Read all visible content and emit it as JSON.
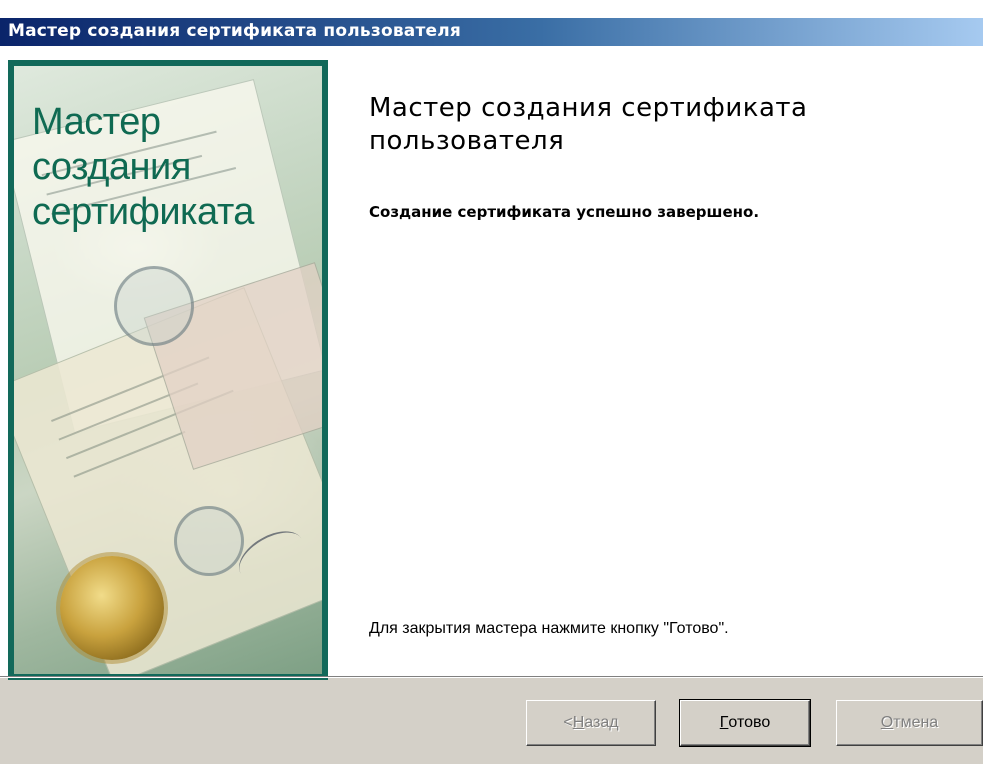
{
  "window": {
    "title": "Мастер создания сертификата пользователя"
  },
  "side_panel": {
    "title_lines": [
      "Мастер",
      "создания",
      "сертификата"
    ]
  },
  "main": {
    "title": "Мастер создания сертификата пользователя",
    "subtitle": "Создание сертификата успешно завершено.",
    "hint": "Для закрытия мастера нажмите кнопку \"Готово\"."
  },
  "buttons": {
    "back": {
      "prefix": "< ",
      "accel": "Н",
      "rest": "азад",
      "enabled": false
    },
    "finish": {
      "prefix": "",
      "accel": "Г",
      "rest": "отово",
      "enabled": true,
      "default": true
    },
    "cancel": {
      "prefix": "",
      "accel": "О",
      "rest": "тмена",
      "enabled": false
    }
  }
}
